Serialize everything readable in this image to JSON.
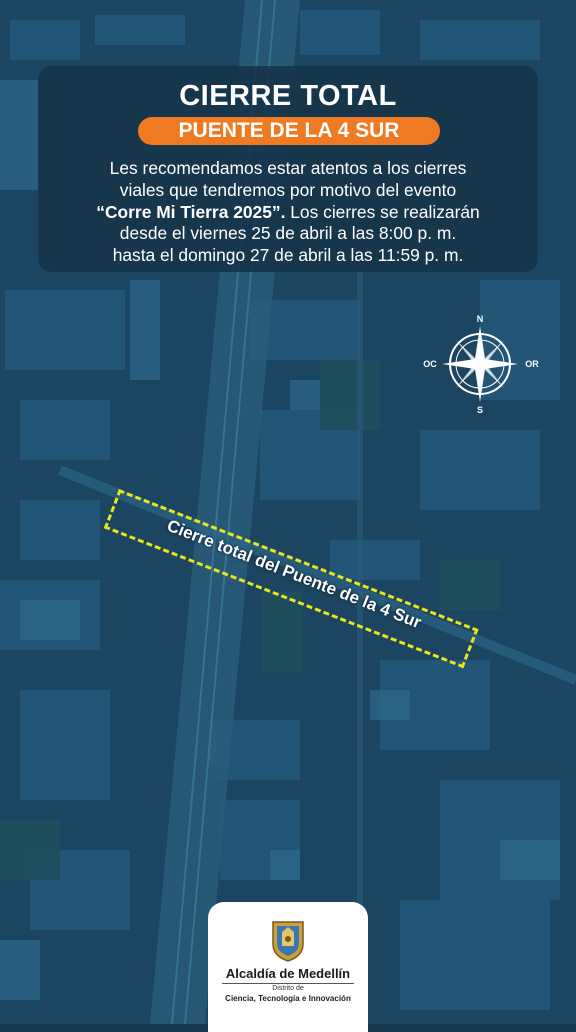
{
  "header": {
    "title": "CIERRE TOTAL",
    "subtitle": "PUENTE DE LA 4 SUR"
  },
  "description": {
    "line1": "Les recomendamos estar atentos a los cierres",
    "line2": "viales que tendremos por motivo del evento",
    "event_name": "“Corre Mi Tierra 2025”.",
    "line3_rest": " Los cierres se realizarán",
    "line4": "desde el viernes 25 de abril a las 8:00 p. m.",
    "line5": "hasta el domingo 27 de abril a las 11:59 p. m."
  },
  "compass": {
    "n": "N",
    "s": "S",
    "e": "OR",
    "w": "OC"
  },
  "closure": {
    "label": "Cierre total del Puente de la 4 Sur"
  },
  "footer": {
    "org_name": "Alcaldía de Medellín",
    "district": "Distrito de",
    "department": "Ciencia, Tecnología e Innovación"
  },
  "colors": {
    "accent_orange": "#ef7a22",
    "closure_yellow": "#e8e61c",
    "panel_navy": "#16344a",
    "map_tint": "#1c4a66"
  }
}
